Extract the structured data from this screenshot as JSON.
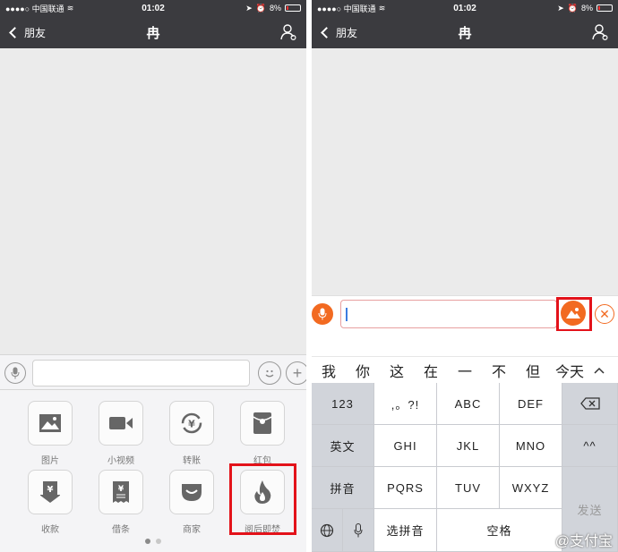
{
  "status": {
    "carrier": "●●●●○ 中国联通",
    "time": "01:02",
    "battery": "8%"
  },
  "nav": {
    "back_label": "朋友",
    "title": "冉"
  },
  "left": {
    "grid": [
      {
        "label": "图片",
        "icon": "image-icon"
      },
      {
        "label": "小视频",
        "icon": "video-icon"
      },
      {
        "label": "转账",
        "icon": "transfer-icon"
      },
      {
        "label": "红包",
        "icon": "red-packet-icon"
      },
      {
        "label": "收款",
        "icon": "receive-icon"
      },
      {
        "label": "借条",
        "icon": "iou-icon"
      },
      {
        "label": "商家",
        "icon": "merchant-icon"
      },
      {
        "label": "阅后即焚",
        "icon": "flame-icon"
      }
    ]
  },
  "right": {
    "candidates": [
      "我",
      "你",
      "这",
      "在",
      "一",
      "不",
      "但",
      "今天"
    ],
    "keys": {
      "k123": "123",
      "punct": ",。?!",
      "abc": "ABC",
      "def": "DEF",
      "english": "英文",
      "ghi": "GHI",
      "jkl": "JKL",
      "mno": "MNO",
      "emoticon": "^^",
      "pinyin": "拼音",
      "pqrs": "PQRS",
      "tuv": "TUV",
      "wxyz": "WXYZ",
      "send": "发送",
      "select_pinyin": "选拼音",
      "space": "空格"
    }
  },
  "watermark": "@支付宝",
  "colors": {
    "nav_bg": "#3b3b3f",
    "accent": "#f26a21",
    "highlight": "#e3121a"
  }
}
